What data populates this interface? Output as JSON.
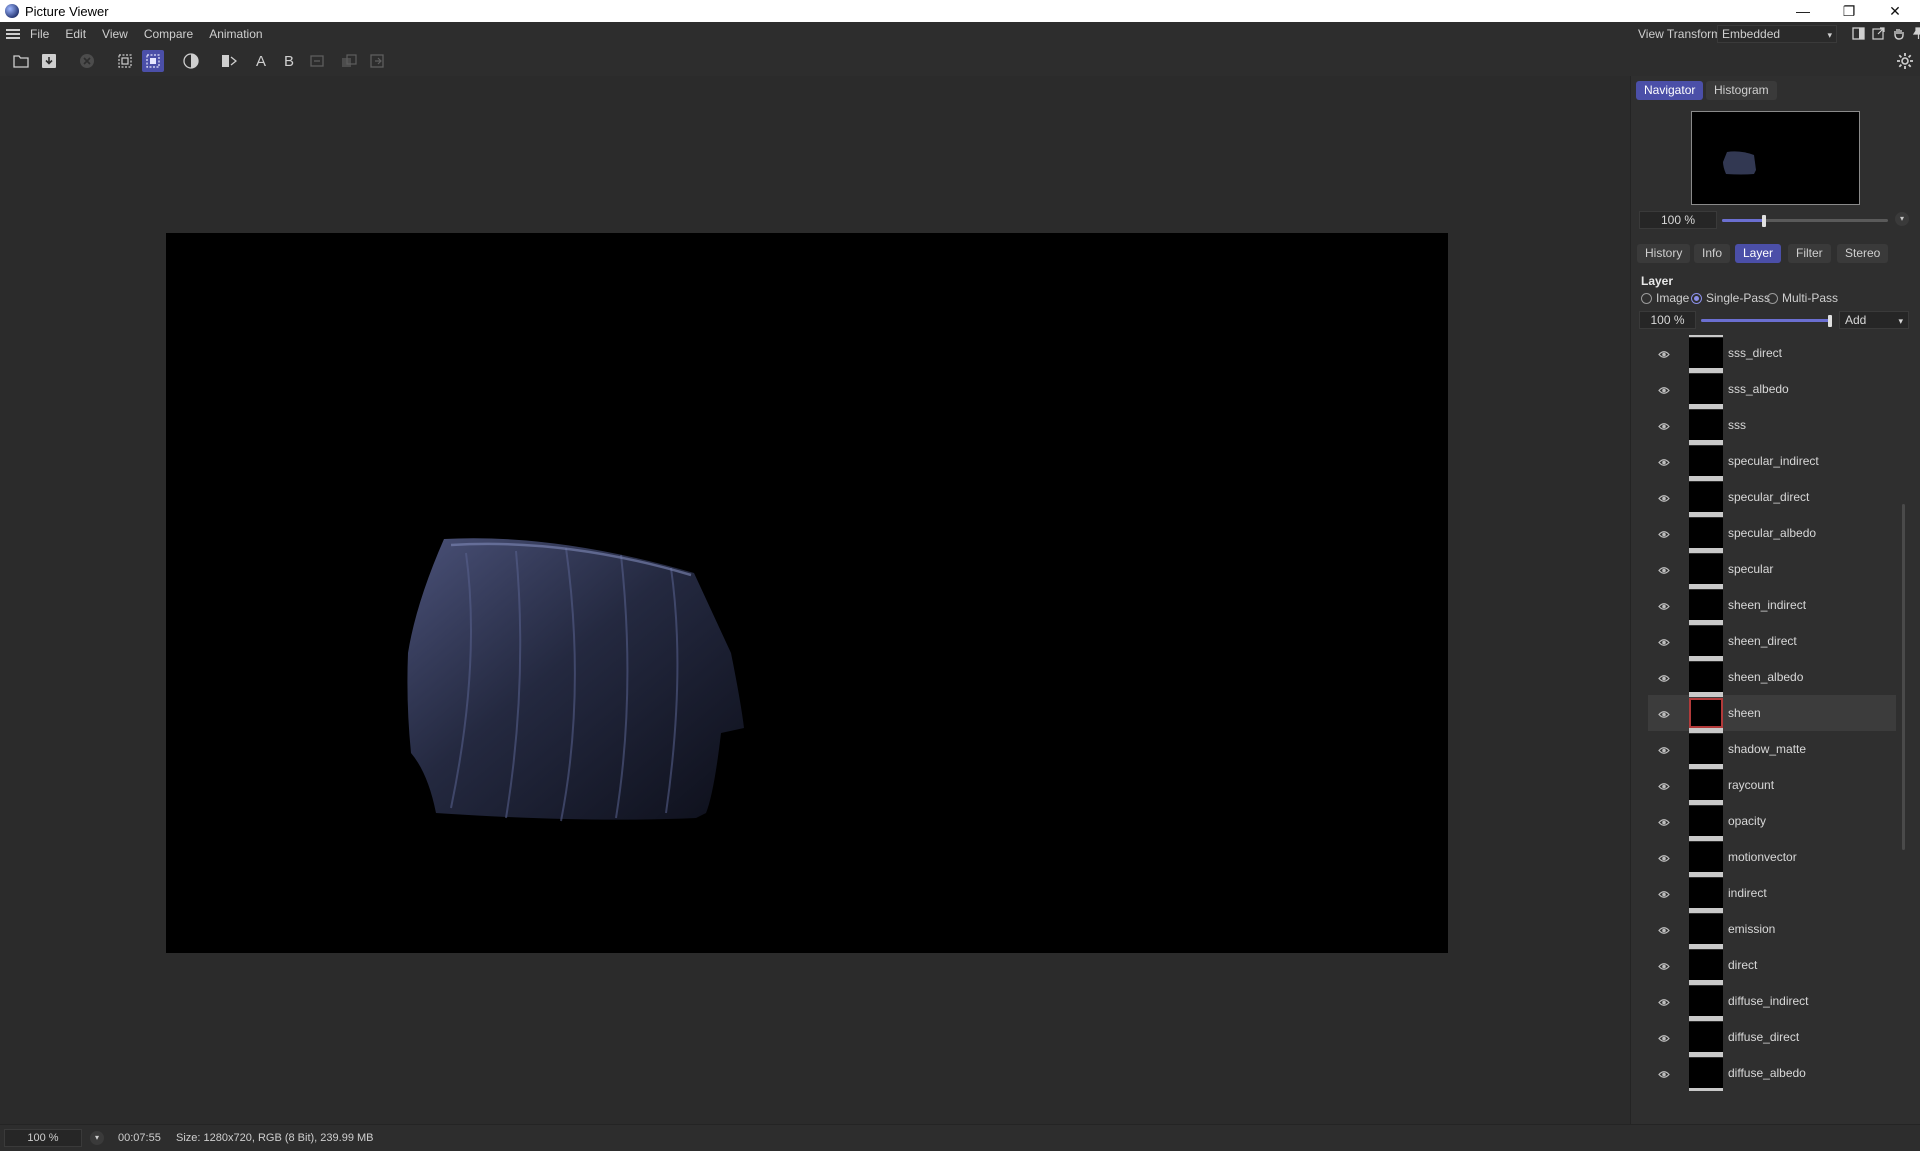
{
  "window": {
    "title": "Picture Viewer",
    "min_glyph": "—",
    "max_glyph": "❐",
    "close_glyph": "✕"
  },
  "menu": [
    "File",
    "Edit",
    "View",
    "Compare",
    "Animation"
  ],
  "view_transform": {
    "label": "View Transform",
    "value": "Embedded",
    "arrow": "▾"
  },
  "toolbar": {
    "buttons": [
      {
        "icon": "open-folder-icon"
      },
      {
        "icon": "save-icon"
      },
      {
        "icon": "stop-render-icon",
        "enabled": false
      },
      {
        "icon": "region-select-icon"
      },
      {
        "icon": "region-render-icon",
        "active": true
      },
      {
        "icon": "contrast-toggle-icon"
      },
      {
        "icon": "compare-swap-icon"
      },
      {
        "icon": "compare-a-icon",
        "text": "A"
      },
      {
        "icon": "compare-b-icon",
        "text": "B"
      },
      {
        "icon": "compare-split-icon",
        "enabled": false
      },
      {
        "icon": "layer-compare-icon",
        "enabled": false
      },
      {
        "icon": "export-compare-icon",
        "enabled": false
      }
    ]
  },
  "sidebar": {
    "top_tabs": [
      "Navigator",
      "Histogram"
    ],
    "top_active": "Navigator",
    "navigator": {
      "zoom": "100 %",
      "zoom_fraction": 0.25
    },
    "tabs": [
      "History",
      "Info",
      "Layer",
      "Filter",
      "Stereo"
    ],
    "active_tab": "Layer",
    "layer": {
      "title": "Layer",
      "modes": [
        "Image",
        "Single-Pass",
        "Multi-Pass"
      ],
      "selected_mode": "Single-Pass",
      "opacity": "100 %",
      "opacity_fraction": 1.0,
      "blend": "Add",
      "blend_arrow": "▾",
      "items": [
        "sss_direct",
        "sss_albedo",
        "sss",
        "specular_indirect",
        "specular_direct",
        "specular_albedo",
        "specular",
        "sheen_indirect",
        "sheen_direct",
        "sheen_albedo",
        "sheen",
        "shadow_matte",
        "raycount",
        "opacity",
        "motionvector",
        "indirect",
        "emission",
        "direct",
        "diffuse_indirect",
        "diffuse_direct",
        "diffuse_albedo"
      ],
      "selected_item": "sheen"
    }
  },
  "status": {
    "zoom": "100 %",
    "time": "00:07:55",
    "size": "Size: 1280x720, RGB (8 Bit), 239.99 MB",
    "dropdown_glyph": "▾"
  },
  "colors": {
    "accent": "#4b4fa8",
    "background": "#2b2b2b",
    "panel": "#2f2f2f",
    "selection_outline": "#b23a3a",
    "cloth": "#3a4060"
  }
}
